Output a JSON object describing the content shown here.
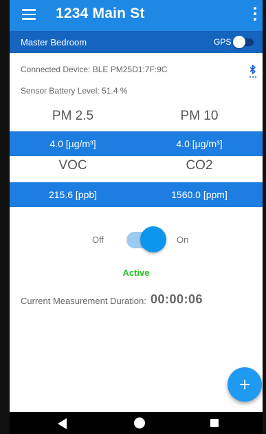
{
  "appbar": {
    "title": "1234 Main St",
    "menu_icon": "hamburger-menu-icon",
    "overflow_icon": "more-vert-icon",
    "color": "#1e88e5"
  },
  "subbar": {
    "room": "Master Bedroom",
    "gps_label": "GPS",
    "gps_enabled": false,
    "color": "#1565c0"
  },
  "device": {
    "connected_label": "Connected Device:",
    "connected_value": "BLE PM25D1:7F:9C",
    "battery_label": "Sensor Battery Level:",
    "battery_value": "51.4 %",
    "bluetooth_icon": "bluetooth-searching-icon"
  },
  "metrics": {
    "pm25": {
      "label": "PM 2.5",
      "value": "4.0 [µg/m³]"
    },
    "pm10": {
      "label": "PM 10",
      "value": "4.0 [µg/m³]"
    },
    "voc": {
      "label": "VOC",
      "value": "215.6 [ppb]"
    },
    "co2": {
      "label": "CO2",
      "value": "1560.0 [ppm]"
    },
    "bar_color": "#1e7de0"
  },
  "toggle": {
    "off_label": "Off",
    "on_label": "On",
    "is_on": true
  },
  "status": {
    "text": "Active",
    "color": "#22c322"
  },
  "duration": {
    "label": "Current Measurement Duration:",
    "value": "00:00:06"
  },
  "fab": {
    "icon": "plus-icon"
  },
  "navbar": {
    "back_icon": "back-triangle-icon",
    "home_icon": "home-circle-icon",
    "recent_icon": "recent-apps-icon"
  }
}
